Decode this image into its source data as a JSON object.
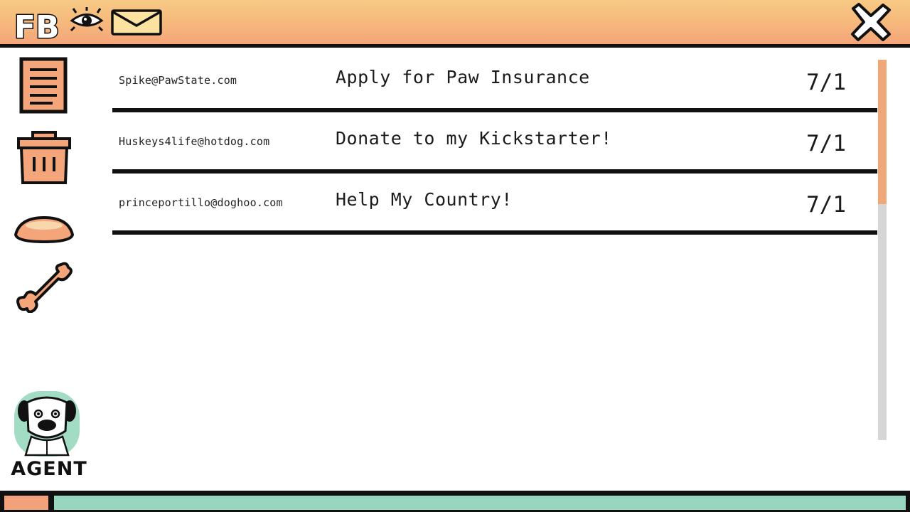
{
  "colors": {
    "topbar_top": "#f7c985",
    "topbar_bottom": "#f4a57a",
    "accent_orange": "#f0a878",
    "agent_bg": "#a3dcc5",
    "taskbar_teal": "#97d6bf",
    "scroll_track": "#d6d6d6"
  },
  "topbar": {
    "logo_text": "FB",
    "icons": [
      "eye-icon",
      "mail-icon"
    ],
    "close_icon": "close-icon"
  },
  "sidebar": {
    "items": [
      {
        "name": "document-icon"
      },
      {
        "name": "trash-icon"
      },
      {
        "name": "dog-bowl-icon"
      },
      {
        "name": "bone-icon"
      }
    ],
    "agent_label": "AGENT"
  },
  "emails": [
    {
      "sender": "Spike@PawState.com",
      "subject": "Apply for Paw Insurance",
      "date": "7/1"
    },
    {
      "sender": "Huskeys4life@hotdog.com",
      "subject": "Donate to my Kickstarter!",
      "date": "7/1"
    },
    {
      "sender": "princeportillo@doghoo.com",
      "subject": "Help My Country!",
      "date": "7/1"
    }
  ],
  "scroll": {
    "position_fraction": 0.0,
    "visible_fraction": 0.38
  }
}
